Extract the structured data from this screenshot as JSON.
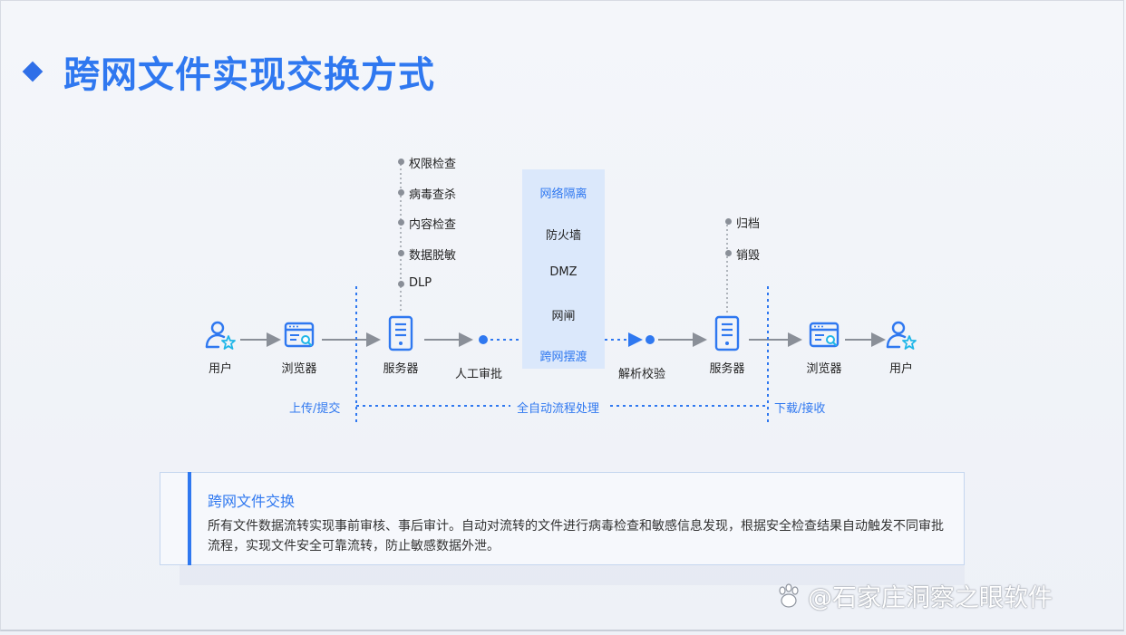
{
  "title": "跨网文件实现交换方式",
  "flow": {
    "user_left": "用户",
    "browser_left": "浏览器",
    "server_left": "服务器",
    "manual_review": "人工审批",
    "parse_verify": "解析校验",
    "server_right": "服务器",
    "browser_right": "浏览器",
    "user_right": "用户"
  },
  "checks": [
    "权限检查",
    "病毒查杀",
    "内容检查",
    "数据脱敏",
    "DLP"
  ],
  "post_actions": [
    "归档",
    "销毁"
  ],
  "isolation_zone": {
    "header": "网络隔离",
    "items": [
      "防火墙",
      "DMZ",
      "网闸"
    ],
    "footer": "跨网摆渡"
  },
  "phases": {
    "upload": "上传/提交",
    "auto": "全自动流程处理",
    "download": "下载/接收"
  },
  "card": {
    "title": "跨网文件交换",
    "body": "所有文件数据流转实现事前审核、事后审计。自动对流转的文件进行病毒检查和敏感信息发现，根据安全检查结果自动触发不同审批流程，实现文件安全可靠流转，防止敏感数据外泄。"
  },
  "watermark": "@石家庄洞察之眼软件",
  "colors": {
    "accent": "#2f78f0",
    "zone": "#dbe8fb",
    "arrow": "#8a8f98"
  }
}
